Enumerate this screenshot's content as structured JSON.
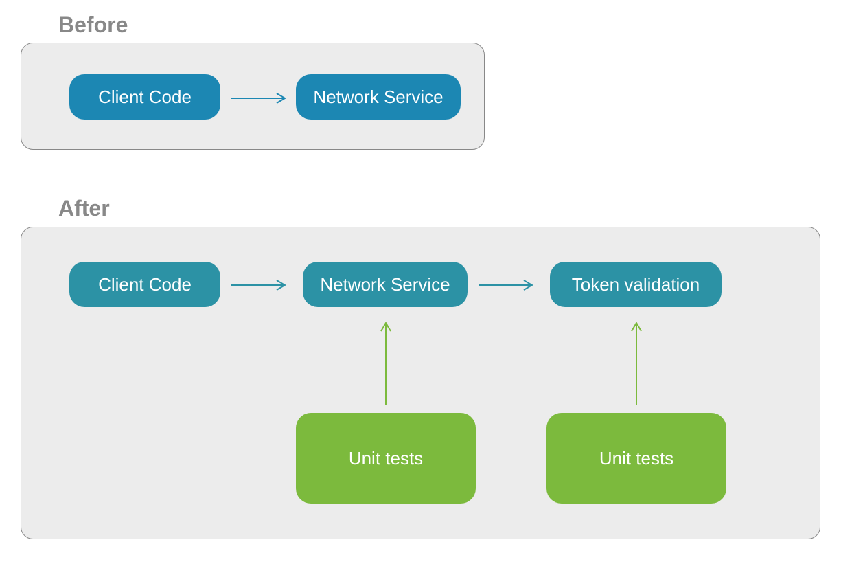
{
  "sections": {
    "before": {
      "label": "Before"
    },
    "after": {
      "label": "After"
    }
  },
  "before_panel": {
    "nodes": {
      "client": {
        "label": "Client Code"
      },
      "network": {
        "label": "Network Service"
      }
    }
  },
  "after_panel": {
    "nodes": {
      "client": {
        "label": "Client Code"
      },
      "network": {
        "label": "Network Service"
      },
      "token": {
        "label": "Token validation"
      },
      "unit1": {
        "label": "Unit tests"
      },
      "unit2": {
        "label": "Unit tests"
      }
    }
  },
  "colors": {
    "panel_bg": "#ececec",
    "panel_border": "#888888",
    "label_gray": "#888888",
    "blue": "#1c87b3",
    "teal": "#2c92a5",
    "green": "#7cba3d"
  }
}
